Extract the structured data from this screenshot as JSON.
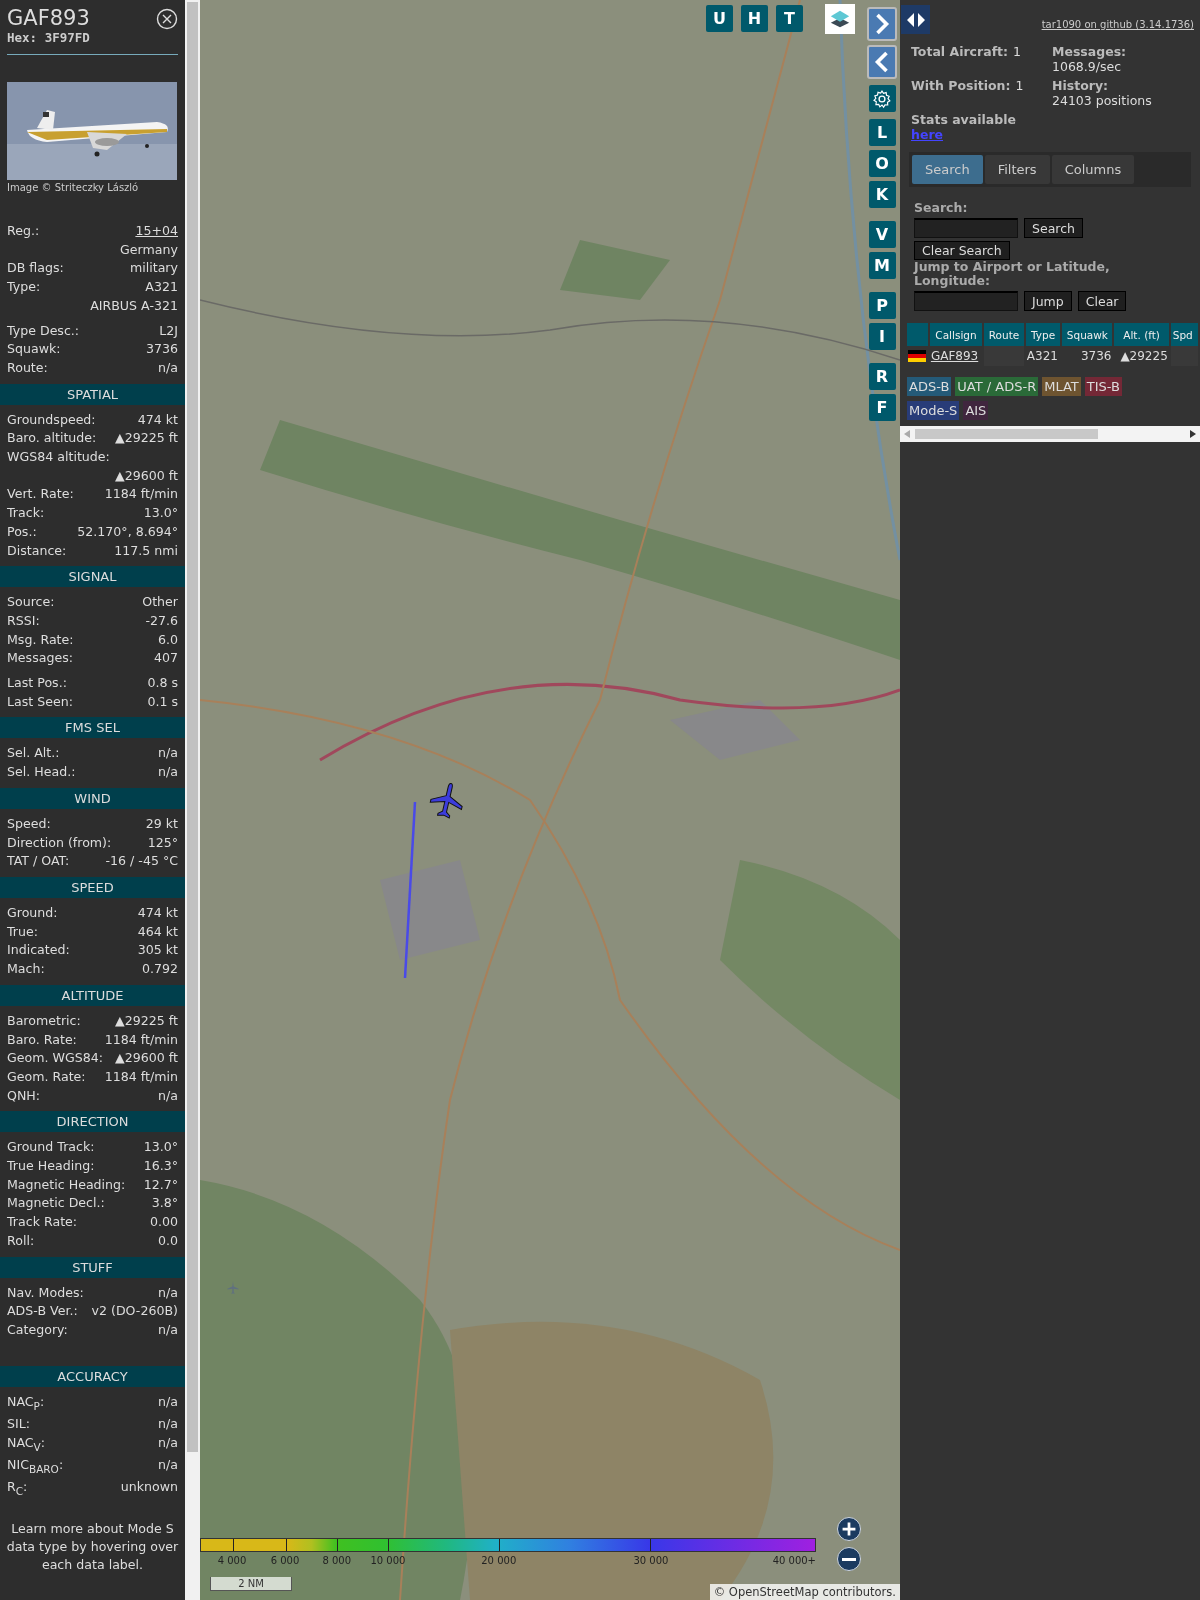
{
  "aircraft": {
    "callsign": "GAF893",
    "hex": "Hex: 3F97FD",
    "image_credit": "Image © Striteczky László"
  },
  "sections": [
    {
      "blocks": [
        [
          {
            "kind": "link",
            "label": "Reg.:",
            "value": "15+04"
          },
          {
            "kind": "more",
            "value": "Germany"
          },
          {
            "kind": "pair",
            "label": "DB flags:",
            "value": "military"
          },
          {
            "kind": "pair",
            "label": "Type:",
            "value": "A321"
          },
          {
            "kind": "more",
            "value": "AIRBUS A-321"
          }
        ],
        [
          {
            "kind": "pair",
            "label": "Type Desc.:",
            "value": "L2J"
          },
          {
            "kind": "pair",
            "label": "Squawk:",
            "value": "3736"
          },
          {
            "kind": "pair",
            "label": "Route:",
            "value": "n/a"
          }
        ]
      ]
    },
    {
      "title": "SPATIAL",
      "blocks": [
        [
          {
            "kind": "pair",
            "label": "Groundspeed:",
            "value": "474 kt"
          },
          {
            "kind": "pair",
            "label": "Baro. altitude:",
            "value": "▲29225 ft"
          },
          {
            "kind": "wrapped",
            "label": "WGS84 altitude:",
            "value": "▲29600 ft"
          },
          {
            "kind": "pair",
            "label": "Vert. Rate:",
            "value": "1184 ft/min"
          },
          {
            "kind": "pair",
            "label": "Track:",
            "value": "13.0°"
          },
          {
            "kind": "pair",
            "label": "Pos.:",
            "value": "52.170°, 8.694°"
          },
          {
            "kind": "pair",
            "label": "Distance:",
            "value": "117.5 nmi"
          }
        ]
      ]
    },
    {
      "title": "SIGNAL",
      "blocks": [
        [
          {
            "kind": "pair",
            "label": "Source:",
            "value": "Other"
          },
          {
            "kind": "pair",
            "label": "RSSI:",
            "value": "-27.6"
          },
          {
            "kind": "pair",
            "label": "Msg. Rate:",
            "value": "6.0"
          },
          {
            "kind": "pair",
            "label": "Messages:",
            "value": "407"
          }
        ],
        [
          {
            "kind": "pair",
            "label": "Last Pos.:",
            "value": "0.8 s"
          },
          {
            "kind": "pair",
            "label": "Last Seen:",
            "value": "0.1 s"
          }
        ]
      ]
    },
    {
      "title": "FMS SEL",
      "blocks": [
        [
          {
            "kind": "pair",
            "label": "Sel. Alt.:",
            "value": "n/a"
          },
          {
            "kind": "pair",
            "label": "Sel. Head.:",
            "value": "n/a"
          }
        ]
      ]
    },
    {
      "title": "WIND",
      "blocks": [
        [
          {
            "kind": "pair",
            "label": "Speed:",
            "value": "29 kt"
          },
          {
            "kind": "pair",
            "label": "Direction (from):",
            "value": "125°"
          },
          {
            "kind": "pair",
            "label": "TAT / OAT:",
            "value": "-16 / -45 °C"
          }
        ]
      ]
    },
    {
      "title": "SPEED",
      "blocks": [
        [
          {
            "kind": "pair",
            "label": "Ground:",
            "value": "474 kt"
          },
          {
            "kind": "pair",
            "label": "True:",
            "value": "464 kt"
          },
          {
            "kind": "pair",
            "label": "Indicated:",
            "value": "305 kt"
          },
          {
            "kind": "pair",
            "label": "Mach:",
            "value": "0.792"
          }
        ]
      ]
    },
    {
      "title": "ALTITUDE",
      "blocks": [
        [
          {
            "kind": "pair",
            "label": "Barometric:",
            "value": "▲29225 ft"
          },
          {
            "kind": "pair",
            "label": "Baro. Rate:",
            "value": "1184 ft/min"
          },
          {
            "kind": "pair",
            "label": "Geom. WGS84:",
            "value": "▲29600 ft"
          },
          {
            "kind": "pair",
            "label": "Geom. Rate:",
            "value": "1184 ft/min"
          },
          {
            "kind": "pair",
            "label": "QNH:",
            "value": "n/a"
          }
        ]
      ]
    },
    {
      "title": "DIRECTION",
      "blocks": [
        [
          {
            "kind": "pair",
            "label": "Ground Track:",
            "value": "13.0°"
          },
          {
            "kind": "pair",
            "label": "True Heading:",
            "value": "16.3°"
          },
          {
            "kind": "pair",
            "label": "Magnetic Heading:",
            "value": "12.7°"
          },
          {
            "kind": "pair",
            "label": "Magnetic Decl.:",
            "value": "3.8°"
          },
          {
            "kind": "pair",
            "label": "Track Rate:",
            "value": "0.00"
          },
          {
            "kind": "pair",
            "label": "Roll:",
            "value": "0.0"
          }
        ]
      ]
    },
    {
      "title": "STUFF",
      "blocks": [
        [
          {
            "kind": "pair",
            "label": "Nav. Modes:",
            "value": "n/a"
          },
          {
            "kind": "pair",
            "label": "ADS-B Ver.:",
            "value": "v2 (DO-260B)"
          },
          {
            "kind": "pair",
            "label": "Category:",
            "value": "n/a"
          }
        ]
      ]
    },
    {
      "title": "ACCURACY",
      "blocks": [
        [
          {
            "kind": "pair",
            "label": "NAC$_{P}$:",
            "value": "n/a"
          },
          {
            "kind": "pair",
            "label": "SIL:",
            "value": "n/a"
          },
          {
            "kind": "pair",
            "label": "NAC$_{V}$:",
            "value": "n/a"
          },
          {
            "kind": "pair",
            "label": "NIC$_{BARO}$:",
            "value": "n/a"
          },
          {
            "kind": "pair",
            "label": "R$_{C}$:",
            "value": "unknown"
          }
        ]
      ]
    }
  ],
  "note": "Learn more about Mode S data type by hovering over each data label.",
  "map": {
    "top_buttons": [
      "U",
      "H",
      "T"
    ],
    "side_buttons": [
      [
        "L",
        "O",
        "K"
      ],
      [
        "V",
        "M"
      ],
      [
        "P",
        "I"
      ],
      [
        "R",
        "F"
      ]
    ],
    "color_scale": [
      "4 000",
      "6 000",
      "8 000",
      "10 000",
      "20 000",
      "30 000",
      "40 000+"
    ],
    "scale": "2 NM",
    "attribution": "© OpenStreetMap contributors."
  },
  "panel": {
    "version_link": "tar1090 on github (3.14.1736)",
    "stats": [
      {
        "label": "Total Aircraft:",
        "value": "1"
      },
      {
        "label": "Messages:",
        "value": "1068.9/sec"
      },
      {
        "label": "With Position:",
        "value": "1"
      },
      {
        "label": "History:",
        "value": "24103 positions"
      }
    ],
    "stats_text": "Stats available",
    "stats_link": "here",
    "tabs": [
      {
        "label": "Search",
        "selected": true
      },
      {
        "label": "Filters",
        "selected": false
      },
      {
        "label": "Columns",
        "selected": false
      }
    ],
    "search": {
      "label": "Search:",
      "button": "Search",
      "clear": "Clear Search"
    },
    "jump": {
      "label": "Jump to Airport or Latitude, Longitude:",
      "button": "Jump",
      "clear": "Clear"
    },
    "table": {
      "columns": [
        "Callsign",
        "Route",
        "Type",
        "Squawk",
        "Alt. (ft)",
        "Spd"
      ],
      "rows": [
        {
          "callsign": "GAF893",
          "type": "A321",
          "squawk": "3736",
          "altitude": "▲29225"
        }
      ]
    },
    "sources": [
      {
        "label": "ADS-B",
        "color": "#245a78"
      },
      {
        "label": "UAT / ADS-R",
        "color": "#2a6a38"
      },
      {
        "label": "MLAT",
        "color": "#6e5430"
      },
      {
        "label": "TIS-B",
        "color": "#742836"
      },
      {
        "label": "Mode-S",
        "color": "#283c78"
      },
      {
        "label": "AIS",
        "color": "#40263e"
      }
    ]
  }
}
